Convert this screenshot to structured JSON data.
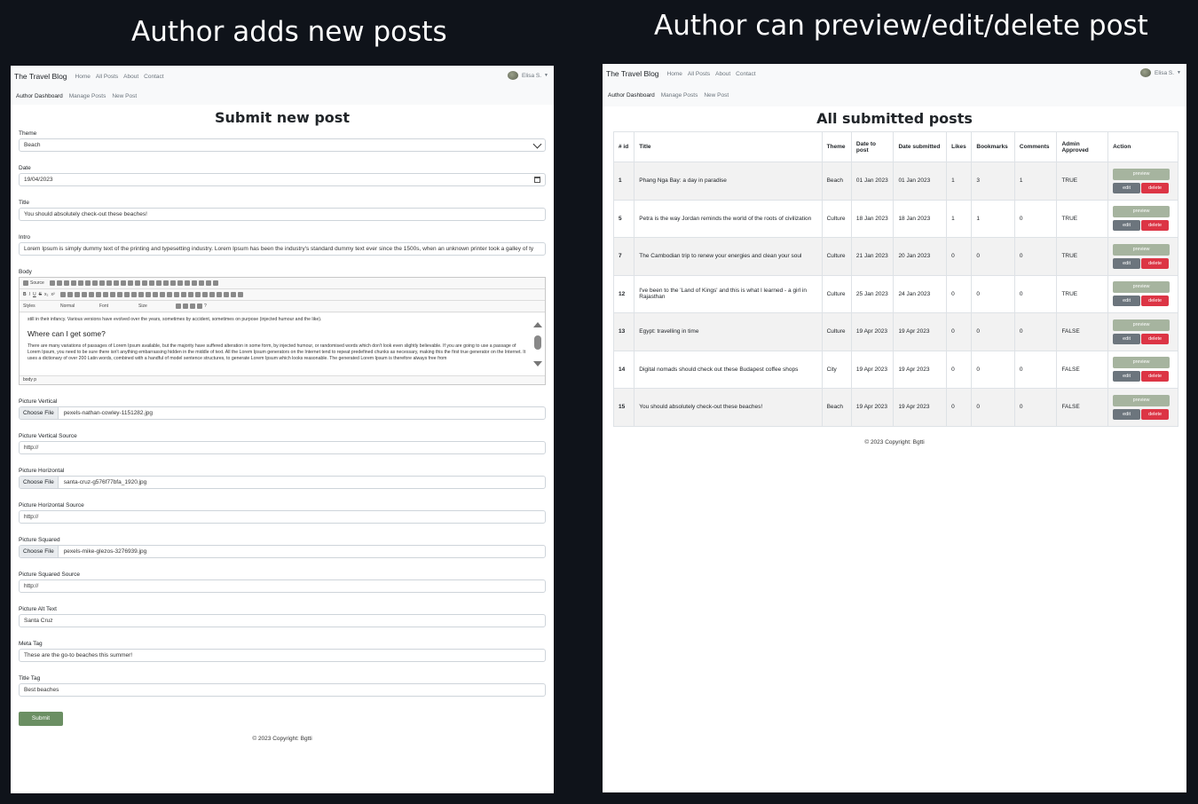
{
  "captions": {
    "left": "Author adds new posts",
    "right": "Author can preview/edit/delete post"
  },
  "navbar": {
    "brand": "The Travel Blog",
    "links": [
      "Home",
      "All Posts",
      "About",
      "Contact"
    ],
    "user": "Elisa S."
  },
  "subnav": {
    "active": "Author Dashboard",
    "links": [
      "Manage Posts",
      "New Post"
    ]
  },
  "form": {
    "heading": "Submit new post",
    "theme_label": "Theme",
    "theme_value": "Beach",
    "date_label": "Date",
    "date_value": "19/04/2023",
    "title_label": "Title",
    "title_value": "You should absolutely check-out these beaches!",
    "intro_label": "Intro",
    "intro_value": "Lorem Ipsum is simply dummy text of the printing and typesetting industry. Lorem Ipsum has been the industry's standard dummy text ever since the 1500s, when an unknown printer took a galley of ty",
    "body_label": "Body",
    "editor": {
      "source_label": "Source",
      "styles": "Styles",
      "normal": "Normal",
      "font": "Font",
      "size": "Size",
      "para1": "still in their infancy. Various versions have evolved over the years, sometimes by accident, sometimes on purpose (injected humour and the like).",
      "heading": "Where can I get some?",
      "para2": "There are many variations of passages of Lorem Ipsum available, but the majority have suffered alteration in some form, by injected humour, or randomised words which don't look even slightly believable. If you are going to use a passage of Lorem Ipsum, you need to be sure there isn't anything embarrassing hidden in the middle of text. All the Lorem Ipsum generators on the Internet tend to repeat predefined chunks as necessary, making this the first true generator on the Internet. It uses a dictionary of over 200 Latin words, combined with a handful of model sentence structures, to generate Lorem Ipsum which looks reasonable. The generated Lorem Ipsum is therefore always free from",
      "path": "body  p"
    },
    "choose_file": "Choose File",
    "pv_label": "Picture Vertical",
    "pv_file": "pexels-nathan-cowley-1151282.jpg",
    "pvs_label": "Picture Vertical Source",
    "pvs_value": "http://",
    "ph_label": "Picture Horizontal",
    "ph_file": "santa-cruz-g576f77bfa_1920.jpg",
    "phs_label": "Picture Horizontal Source",
    "phs_value": "http://",
    "psq_label": "Picture Squared",
    "psq_file": "pexels-mike-glezos-3276939.jpg",
    "psqs_label": "Picture Squared Source",
    "psqs_value": "http://",
    "alt_label": "Picture Alt Text",
    "alt_value": "Santa Cruz",
    "meta_label": "Meta Tag",
    "meta_value": "These are the go-to beaches this summer!",
    "titletag_label": "Title Tag",
    "titletag_value": "Best beaches",
    "submit": "Submit"
  },
  "footer": "© 2023 Copyright: Bgtti",
  "posts": {
    "heading": "All submitted posts",
    "headers": {
      "id": "# id",
      "title": "Title",
      "theme": "Theme",
      "date_to_post": "Date to post",
      "date_submitted": "Date submitted",
      "likes": "Likes",
      "bookmarks": "Bookmarks",
      "comments": "Comments",
      "admin_approved": "Admin Approved",
      "action": "Action"
    },
    "buttons": {
      "preview": "preview",
      "edit": "edit",
      "delete": "delete"
    },
    "rows": [
      {
        "id": "1",
        "title": "Phang Nga Bay: a day in paradise",
        "theme": "Beach",
        "date_to_post": "01 Jan 2023",
        "date_submitted": "01 Jan 2023",
        "likes": "1",
        "bookmarks": "3",
        "comments": "1",
        "approved": "TRUE"
      },
      {
        "id": "5",
        "title": "Petra is the way Jordan reminds the world of the roots of civilization",
        "theme": "Culture",
        "date_to_post": "18 Jan 2023",
        "date_submitted": "18 Jan 2023",
        "likes": "1",
        "bookmarks": "1",
        "comments": "0",
        "approved": "TRUE"
      },
      {
        "id": "7",
        "title": "The Cambodian trip to renew your energies and clean your soul",
        "theme": "Culture",
        "date_to_post": "21 Jan 2023",
        "date_submitted": "20 Jan 2023",
        "likes": "0",
        "bookmarks": "0",
        "comments": "0",
        "approved": "TRUE"
      },
      {
        "id": "12",
        "title": "I've been to the 'Land of Kings' and this is what I learned - a girl in Rajasthan",
        "theme": "Culture",
        "date_to_post": "25 Jan 2023",
        "date_submitted": "24 Jan 2023",
        "likes": "0",
        "bookmarks": "0",
        "comments": "0",
        "approved": "TRUE"
      },
      {
        "id": "13",
        "title": "Egypt: travelling in time",
        "theme": "Culture",
        "date_to_post": "19 Apr 2023",
        "date_submitted": "19 Apr 2023",
        "likes": "0",
        "bookmarks": "0",
        "comments": "0",
        "approved": "FALSE"
      },
      {
        "id": "14",
        "title": "Digital nomads should check out these Budapest coffee shops",
        "theme": "City",
        "date_to_post": "19 Apr 2023",
        "date_submitted": "19 Apr 2023",
        "likes": "0",
        "bookmarks": "0",
        "comments": "0",
        "approved": "FALSE"
      },
      {
        "id": "15",
        "title": "You should absolutely check-out these beaches!",
        "theme": "Beach",
        "date_to_post": "19 Apr 2023",
        "date_submitted": "19 Apr 2023",
        "likes": "0",
        "bookmarks": "0",
        "comments": "0",
        "approved": "FALSE"
      }
    ]
  }
}
